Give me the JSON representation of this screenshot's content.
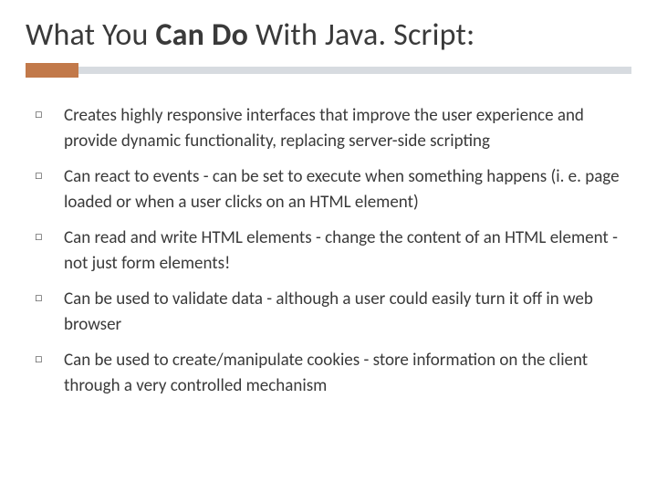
{
  "title": {
    "part1": "What You ",
    "part2": "Can Do",
    "part3": " With Java. Script:"
  },
  "bullets": [
    "Creates highly responsive interfaces that improve the user experience and provide dynamic functionality, replacing server-side scripting",
    "Can react to events - can be set to execute when something happens (i. e. page loaded or when a user clicks on an HTML element)",
    "Can read and write HTML elements - change the content of an HTML element - not just form elements!",
    "Can be used to validate data - although a user could easily turn it off in web browser",
    "Can be used to create/manipulate cookies - store information on the client through a very controlled mechanism"
  ]
}
